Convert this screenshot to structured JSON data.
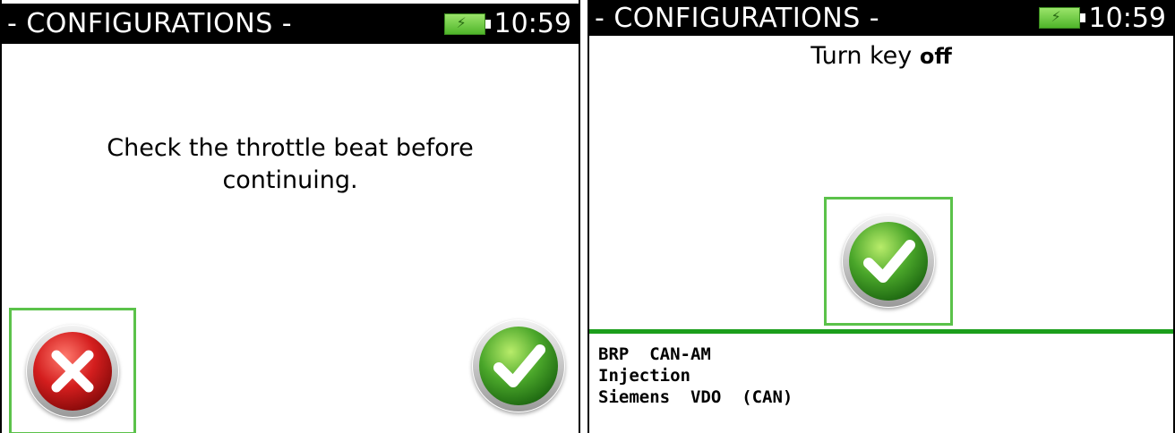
{
  "left_screen": {
    "title": "- CONFIGURATIONS -",
    "clock": "10:59",
    "message_line1": "Check the throttle beat before",
    "message_line2": "continuing.",
    "cancel_icon": "cancel-x-icon",
    "confirm_icon": "checkmark-icon"
  },
  "right_screen": {
    "title": "- CONFIGURATIONS -",
    "clock": "10:59",
    "message_prefix": "Turn key ",
    "message_bold": "off",
    "confirm_icon": "checkmark-icon",
    "info_lines": [
      "BRP  CAN-AM",
      "Injection",
      "Siemens  VDO  (CAN)"
    ]
  },
  "colors": {
    "titlebar": "#000000",
    "frame_green": "#5bc24a",
    "divider_green": "#1c9e1c",
    "battery_green": "#4fb52a",
    "cancel_red": "#d41e1e",
    "confirm_green": "#4aa62a"
  }
}
